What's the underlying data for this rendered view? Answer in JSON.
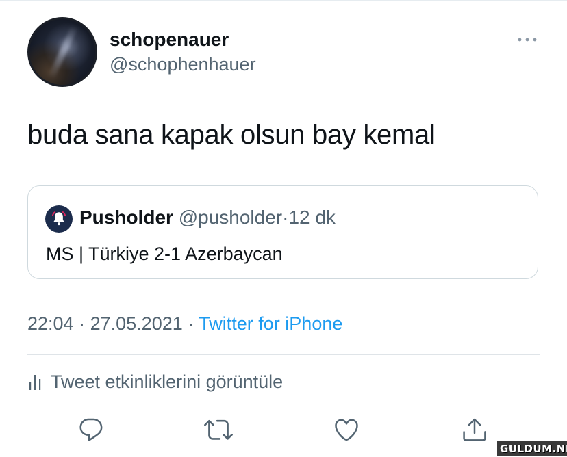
{
  "tweet": {
    "author": {
      "display_name": "schopenauer",
      "handle": "@schophenhauer"
    },
    "more_icon": "more-horizontal-icon",
    "text": "buda sana kapak olsun bay kemal",
    "quoted": {
      "display_name": "Pusholder",
      "handle": "@pusholder",
      "separator": "·",
      "time": "12 dk",
      "text": "MS | Türkiye 2-1 Azerbaycan",
      "avatar_icon": "bell-icon"
    },
    "meta": {
      "time": "22:04",
      "separator": "·",
      "date": "27.05.2021",
      "source_separator": "·",
      "source": "Twitter for iPhone"
    },
    "activity_label": "Tweet etkinliklerini görüntüle",
    "actions": [
      {
        "name": "reply",
        "icon": "reply-icon"
      },
      {
        "name": "retweet",
        "icon": "retweet-icon"
      },
      {
        "name": "like",
        "icon": "heart-icon"
      },
      {
        "name": "share",
        "icon": "share-icon"
      }
    ]
  },
  "colors": {
    "text_primary": "#0f1419",
    "text_secondary": "#536471",
    "link": "#1d9bf0",
    "border": "#cfd9de"
  },
  "watermark": "GULDUM.NET"
}
